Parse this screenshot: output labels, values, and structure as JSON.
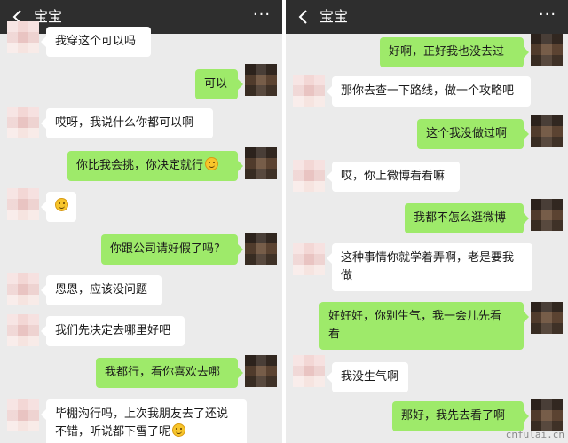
{
  "left": {
    "title": "宝宝",
    "messages": [
      "我穿这个可以吗",
      "可以",
      "哎呀，我说什么你都可以啊",
      "你比我会挑，你决定就行",
      "你跟公司请好假了吗?",
      "恩恩，应该没问题",
      "我们先决定去哪里好吧",
      "我都行，看你喜欢去哪",
      "毕棚沟行吗，上次我朋友去了还说",
      "不错，听说都下雪了呢"
    ]
  },
  "right": {
    "title": "宝宝",
    "messages": [
      "好啊，正好我也没去过",
      "那你去查一下路线，做一个攻略吧",
      "这个我没做过啊",
      "哎，你上微博看看嘛",
      "我都不怎么逛微博",
      "这种事情你就学着弄啊，老是要我",
      "做",
      "好好好，你别生气，我一会儿先看",
      "看",
      "我没生气啊",
      "那好，我先去看了啊"
    ]
  },
  "watermark": "cnfulai.cn",
  "colors": {
    "titlebar": "#2e2e2e",
    "background": "#ebebeb",
    "outgoing_bubble": "#9eea6a",
    "incoming_bubble": "#ffffff"
  },
  "icons": {
    "back": "chevron-left-icon",
    "more": "more-dots-icon",
    "emoji": "grin-emoji-icon"
  }
}
